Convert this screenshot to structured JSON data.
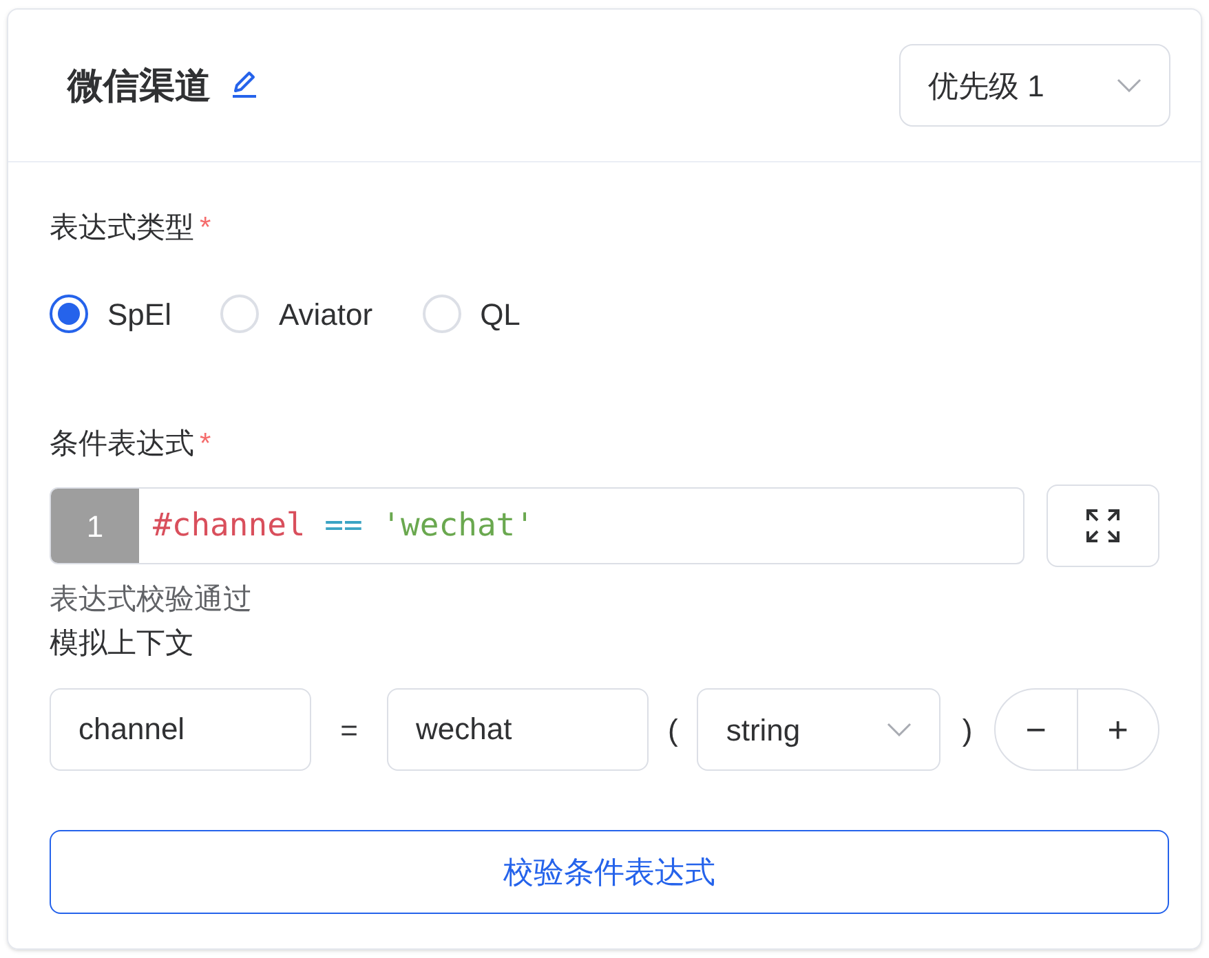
{
  "header": {
    "title": "微信渠道",
    "priority_select": {
      "value": "优先级 1"
    }
  },
  "expression_type": {
    "label": "表达式类型",
    "required_mark": "*",
    "options": [
      {
        "label": "SpEl",
        "selected": true
      },
      {
        "label": "Aviator",
        "selected": false
      },
      {
        "label": "QL",
        "selected": false
      }
    ]
  },
  "condition": {
    "label": "条件表达式",
    "required_mark": "*",
    "line_number": "1",
    "tokens": [
      {
        "text": "#channel",
        "kind": "variable"
      },
      {
        "text": "==",
        "kind": "operator"
      },
      {
        "text": "'wechat'",
        "kind": "string"
      }
    ],
    "validation_message": "表达式校验通过"
  },
  "context": {
    "label": "模拟上下文",
    "rows": [
      {
        "key": "channel",
        "equals": "=",
        "value": "wechat",
        "open_paren": "(",
        "type": "string",
        "close_paren": ")"
      }
    ],
    "minus": "−",
    "plus": "+"
  },
  "validate_button": "校验条件表达式"
}
